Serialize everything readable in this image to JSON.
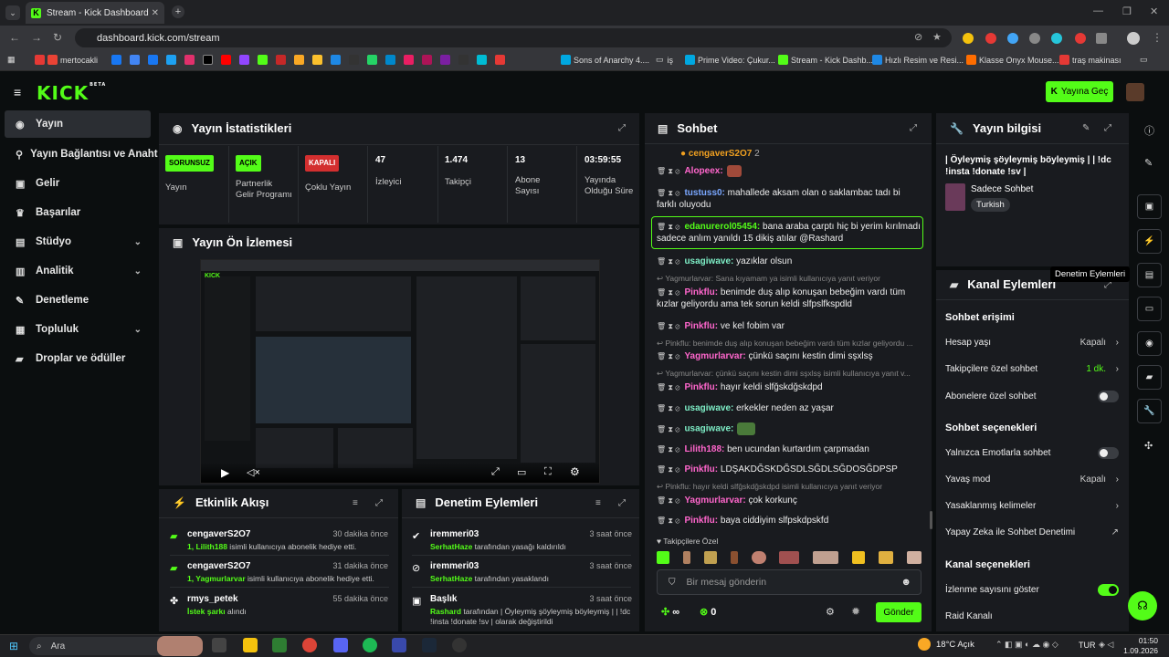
{
  "browser": {
    "tab_title": "Stream - Kick Dashboard",
    "url": "dashboard.kick.com/stream",
    "bookmarks": [
      "mertocakli",
      "Sons of Anarchy 4....",
      "iş",
      "Prime Video: Çukur...",
      "Stream - Kick Dashb...",
      "Hızlı Resim ve Resi...",
      "Klasse Onyx Mouse...",
      "traş makinası"
    ]
  },
  "header": {
    "logo": "KICK",
    "logo_sup": "BETA",
    "go_live": "Yayına Geç"
  },
  "sidebar": {
    "items": [
      {
        "label": "Yayın"
      },
      {
        "label": "Yayın Bağlantısı ve Anahtarı"
      },
      {
        "label": "Gelir"
      },
      {
        "label": "Başarılar"
      },
      {
        "label": "Stüdyo"
      },
      {
        "label": "Analitik"
      },
      {
        "label": "Denetleme"
      },
      {
        "label": "Topluluk"
      },
      {
        "label": "Droplar ve ödüller"
      }
    ]
  },
  "stats": {
    "title": "Yayın İstatistikleri",
    "items": [
      {
        "badge": "SORUNSUZ",
        "label": "Yayın"
      },
      {
        "badge": "AÇIK",
        "label": "Partnerlik Gelir Programı"
      },
      {
        "badge": "KAPALI",
        "label": "Çoklu Yayın"
      },
      {
        "value": "47",
        "label": "İzleyici"
      },
      {
        "value": "1.474",
        "label": "Takipçi"
      },
      {
        "value": "13",
        "label": "Abone Sayısı"
      },
      {
        "value": "03:59:55",
        "label": "Yayında Olduğu Süre"
      }
    ]
  },
  "preview": {
    "title": "Yayın Ön İzlemesi"
  },
  "activity": {
    "title": "Etkinlik Akışı",
    "rows": [
      {
        "name": "cengaverS2O7",
        "time": "30 dakika önce",
        "who": "1, Lilith188",
        "rest": " isimli kullanıcıya abonelik hediye etti."
      },
      {
        "name": "cengaverS2O7",
        "time": "31 dakika önce",
        "who": "1, Yagmurlarvar",
        "rest": " isimli kullanıcıya abonelik hediye etti."
      },
      {
        "name": "rmys_petek",
        "time": "55 dakika önce",
        "who": "İstek şarkı",
        "rest": " alındı"
      }
    ]
  },
  "moderation": {
    "title": "Denetim Eylemleri",
    "rows": [
      {
        "name": "iremmeri03",
        "time": "3 saat önce",
        "who": "SerhatHaze",
        "rest": " tarafından yasağı kaldırıldı"
      },
      {
        "name": "iremmeri03",
        "time": "3 saat önce",
        "who": "SerhatHaze",
        "rest": " tarafından yasaklandı"
      },
      {
        "name": "Başlık",
        "time": "3 saat önce",
        "who": "Rashard",
        "rest": " tarafından | Öyleymiş şöyleymiş böyleymiş | | !dc !insta !donate !sv | olarak değiştirildi"
      }
    ]
  },
  "chat": {
    "title": "Sohbet",
    "pinned_user": "cengaverS2O7",
    "pinned_count": "2",
    "messages": [
      {
        "user": "Alopeex:",
        "color": "#ff66cc",
        "text": ""
      },
      {
        "user": "tustuss0:",
        "color": "#7aa7ff",
        "text": " mahallede aksam olan o saklambac tadı bi farklı oluyodu"
      },
      {
        "user": "edanurerol05454:",
        "color": "#53fc18",
        "text": " bana araba çarptı hiç bi yerim kırılmadı sadece anlım yanıldı 15 dikiş atılar @Rashard"
      },
      {
        "user": "usagiwave:",
        "color": "#7ff0c8",
        "text": " yazıklar olsun"
      },
      {
        "reply": "Yagmurlarvar: Sana kıyamam ya isimli kullanıcıya yanıt veriyor"
      },
      {
        "user": "Pinkflu:",
        "color": "#ff66cc",
        "text": " benimde duş alıp konuşan bebeğim vardı tüm kızlar geliyordu ama tek sorun keldi slfpslfkspdld"
      },
      {
        "user": "Pinkflu:",
        "color": "#ff66cc",
        "text": " ve kel fobim var"
      },
      {
        "reply": "Pinkflu: benimde duş alıp konuşan bebeğim vardı tüm kızlar geliyordu ..."
      },
      {
        "user": "Yagmurlarvar:",
        "color": "#ff66cc",
        "text": " çünkü saçını kestin dimi sşxlsş"
      },
      {
        "reply": "Yagmurlarvar: çünkü saçını kestin dimi sşxlsş isimli kullanıcıya yanıt v..."
      },
      {
        "user": "Pinkflu:",
        "color": "#ff66cc",
        "text": " hayır keldi slfğskdğskdpd"
      },
      {
        "user": "usagiwave:",
        "color": "#7ff0c8",
        "text": " erkekler neden az yaşar"
      },
      {
        "user": "usagiwave:",
        "color": "#7ff0c8",
        "text": ""
      },
      {
        "user": "Lilith188:",
        "color": "#ff66cc",
        "text": " ben ucundan kurtardım çarpmadan"
      },
      {
        "user": "Pinkflu:",
        "color": "#ff66cc",
        "text": " LDŞAKDĞSKDĞSDLSĞDLSĞDOSĞDPSP"
      },
      {
        "reply": "Pinkflu: hayır keldi slfğskdğskdpd isimli kullanıcıya yanıt veriyor"
      },
      {
        "user": "Yagmurlarvar:",
        "color": "#ff66cc",
        "text": " çok korkunç"
      },
      {
        "user": "Pinkflu:",
        "color": "#ff66cc",
        "text": " baya ciddiyim slfpskdpskfd"
      }
    ],
    "followers_only": "Takipçilere Özel",
    "input_placeholder": "Bir mesaj gönderin",
    "infinity": "∞",
    "points": "0",
    "send": "Gönder"
  },
  "stream_info": {
    "title": "Yayın bilgisi",
    "stream_title": "| Öyleymiş şöyleymiş böyleymiş | | !dc !insta !donate !sv |",
    "category": "Sadece Sohbet",
    "language": "Turkish"
  },
  "channel_actions": {
    "title": "Kanal Eylemleri",
    "tooltip": "Denetim Eylemleri",
    "chat_access": "Sohbet erişimi",
    "account_age": "Hesap yaşı",
    "account_age_val": "Kapalı",
    "followers_only": "Takipçilere özel sohbet",
    "followers_only_val": "1 dk.",
    "subs_only": "Abonelere özel sohbet",
    "chat_options": "Sohbet seçenekleri",
    "emotes_only": "Yalnızca Emotlarla sohbet",
    "slow_mode": "Yavaş mod",
    "slow_mode_val": "Kapalı",
    "banned_words": "Yasaklanmış kelimeler",
    "ai_moderation": "Yapay Zeka ile Sohbet Denetimi",
    "channel_options": "Kanal seçenekleri",
    "show_viewers": "İzlenme sayısını göster",
    "raid": "Raid Kanalı"
  },
  "taskbar": {
    "search": "Ara",
    "weather": "18°C  Açık",
    "lang": "TUR",
    "time": "01:50",
    "date": "1.09.2026"
  }
}
